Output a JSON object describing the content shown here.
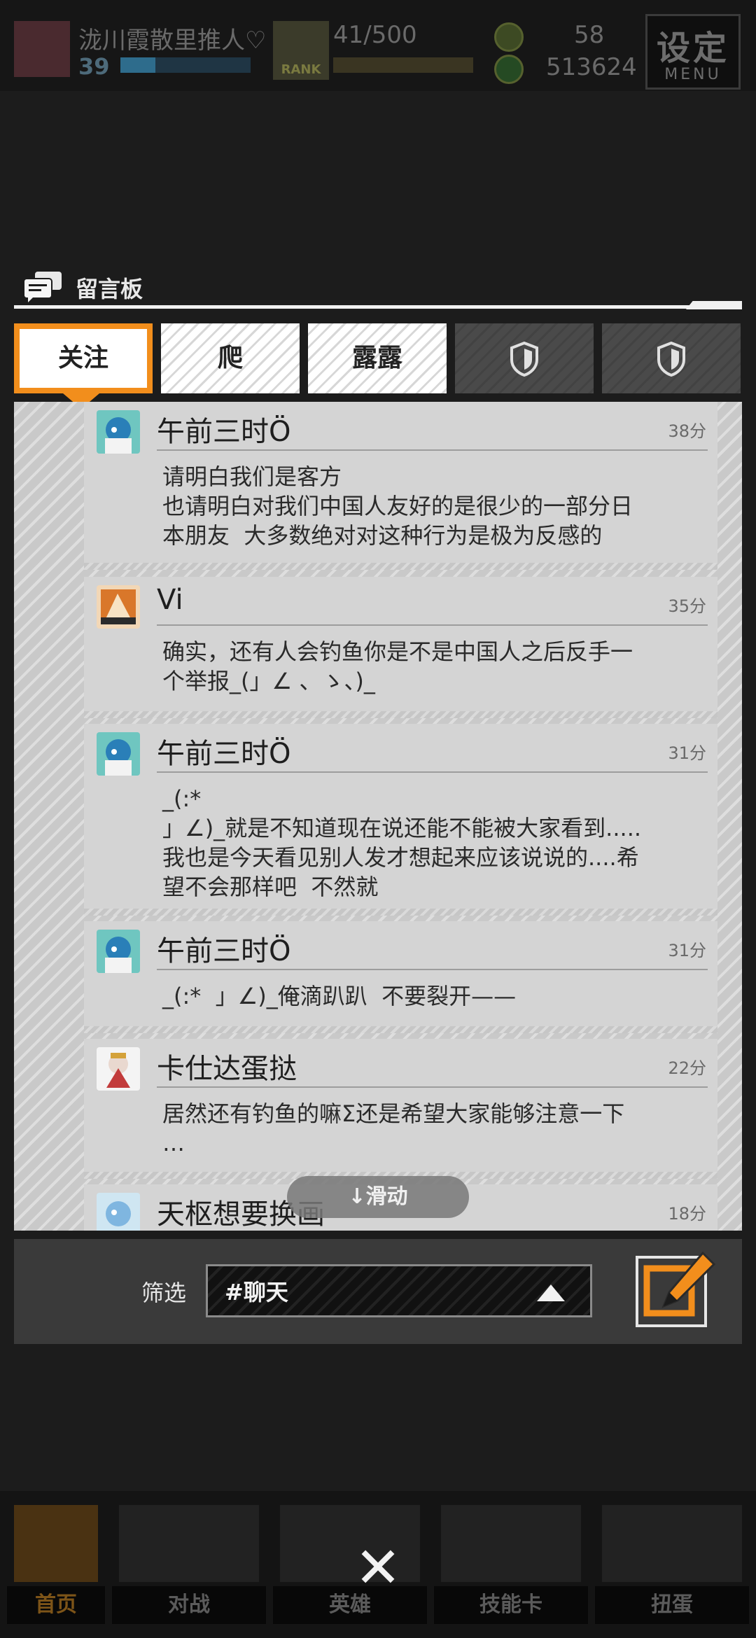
{
  "top_bar": {
    "player_name": "泷川霞散里推人♡",
    "level": "39",
    "rank_label": "RANK",
    "exp": "41/500",
    "currency_1": "58",
    "currency_2": "513624",
    "menu_big": "设定",
    "menu_small": "MENU"
  },
  "board": {
    "title": "留言板",
    "tabs": [
      {
        "label": "关注"
      },
      {
        "label": "爬"
      },
      {
        "label": "露露"
      }
    ],
    "messages": [
      {
        "name": "午前三时Ö",
        "time": "38分",
        "text": "请明白我们是客方\n也请明白对我们中国人友好的是很少的一部分日\n本朋友  大多数绝对对这种行为是极为反感的"
      },
      {
        "name": "Vi",
        "time": "35分",
        "text": "确实，还有人会钓鱼你是不是中国人之后反手一\n个举报_(」∠ 、ゝ、)_"
      },
      {
        "name": "午前三时Ö",
        "time": "31分",
        "text": "_(:*\n」∠)_就是不知道现在说还能不能被大家看到.....\n我也是今天看见别人发才想起来应该说说的....希\n望不会那样吧  不然就"
      },
      {
        "name": "午前三时Ö",
        "time": "31分",
        "text": "_(:*  」∠)_俺滴趴趴  不要裂开——"
      },
      {
        "name": "卡仕达蛋挞",
        "time": "22分",
        "text": "居然还有钓鱼的嘛Σ还是希望大家能够注意一下\n…"
      },
      {
        "name": "天枢想要换画",
        "time": "18分",
        "text": ""
      }
    ],
    "scroll_hint": "↓滑动",
    "filter_label": "筛选",
    "filter_value": "#聊天"
  },
  "bottom_nav": [
    {
      "label": "首页"
    },
    {
      "label": "对战"
    },
    {
      "label": "英雄"
    },
    {
      "label": "技能卡"
    },
    {
      "label": "扭蛋"
    }
  ],
  "colors": {
    "accent": "#f28e1c",
    "panel": "#3a3a3a"
  }
}
